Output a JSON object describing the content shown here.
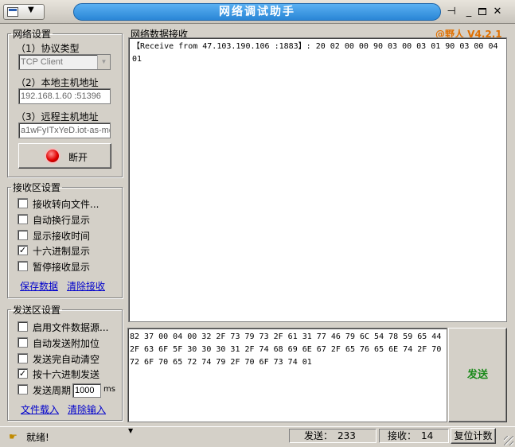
{
  "window": {
    "title": "网络调试助手",
    "version": "@野人 V4.2.1"
  },
  "net_settings": {
    "legend": "网络设置",
    "protocol_label": "（1）协议类型",
    "protocol_value": "TCP Client",
    "local_host_label": "（2）本地主机地址",
    "local_host_value": "192.168.1.60 :51396",
    "remote_host_label": "（3）远程主机地址",
    "remote_host_value": "a1wFyITxYeD.iot-as-mq",
    "disconnect_label": "断开"
  },
  "recv_settings": {
    "legend": "接收区设置",
    "options": [
      {
        "label": "接收转向文件...",
        "checked": false
      },
      {
        "label": "自动换行显示",
        "checked": false
      },
      {
        "label": "显示接收时间",
        "checked": false
      },
      {
        "label": "十六进制显示",
        "checked": true
      },
      {
        "label": "暂停接收显示",
        "checked": false
      }
    ],
    "save_link": "保存数据",
    "clear_link": "清除接收"
  },
  "send_settings": {
    "legend": "发送区设置",
    "options": [
      {
        "label": "启用文件数据源...",
        "checked": false
      },
      {
        "label": "自动发送附加位",
        "checked": false
      },
      {
        "label": "发送完自动清空",
        "checked": false
      },
      {
        "label": "按十六进制发送",
        "checked": true
      },
      {
        "label": "发送周期",
        "checked": false
      }
    ],
    "period_value": "1000",
    "period_unit": "ms",
    "load_link": "文件载入",
    "clear_link": "清除输入"
  },
  "receive_area": {
    "title": "网络数据接收",
    "text": "【Receive from 47.103.190.106 :1883】: 20 02 00 00 90 03 00 03 01 90 03 00 04 01"
  },
  "send_area": {
    "text": "82 37 00 04 00 32 2F 73 79 73 2F 61 31 77 46 79 6C 54 78 59 65 44 2F 63 6F 5F 30 30 30 31 2F 74 68 69 6E 67 2F 65 76 65 6E 74 2F 70 72 6F 70 65 72 74 79 2F 70 6F 73 74 01",
    "send_button": "发送"
  },
  "status": {
    "text": "就绪!",
    "sent_label": "发送：",
    "sent_count": "233",
    "recv_label": "接收：",
    "recv_count": "14",
    "reset_button": "复位计数"
  },
  "icons": [
    "app-icon",
    "dropdown-arrow-icon",
    "pin-icon",
    "minimize-icon",
    "maximize-icon",
    "close-icon",
    "led-indicator-icon",
    "status-icon",
    "resize-grip-icon"
  ]
}
